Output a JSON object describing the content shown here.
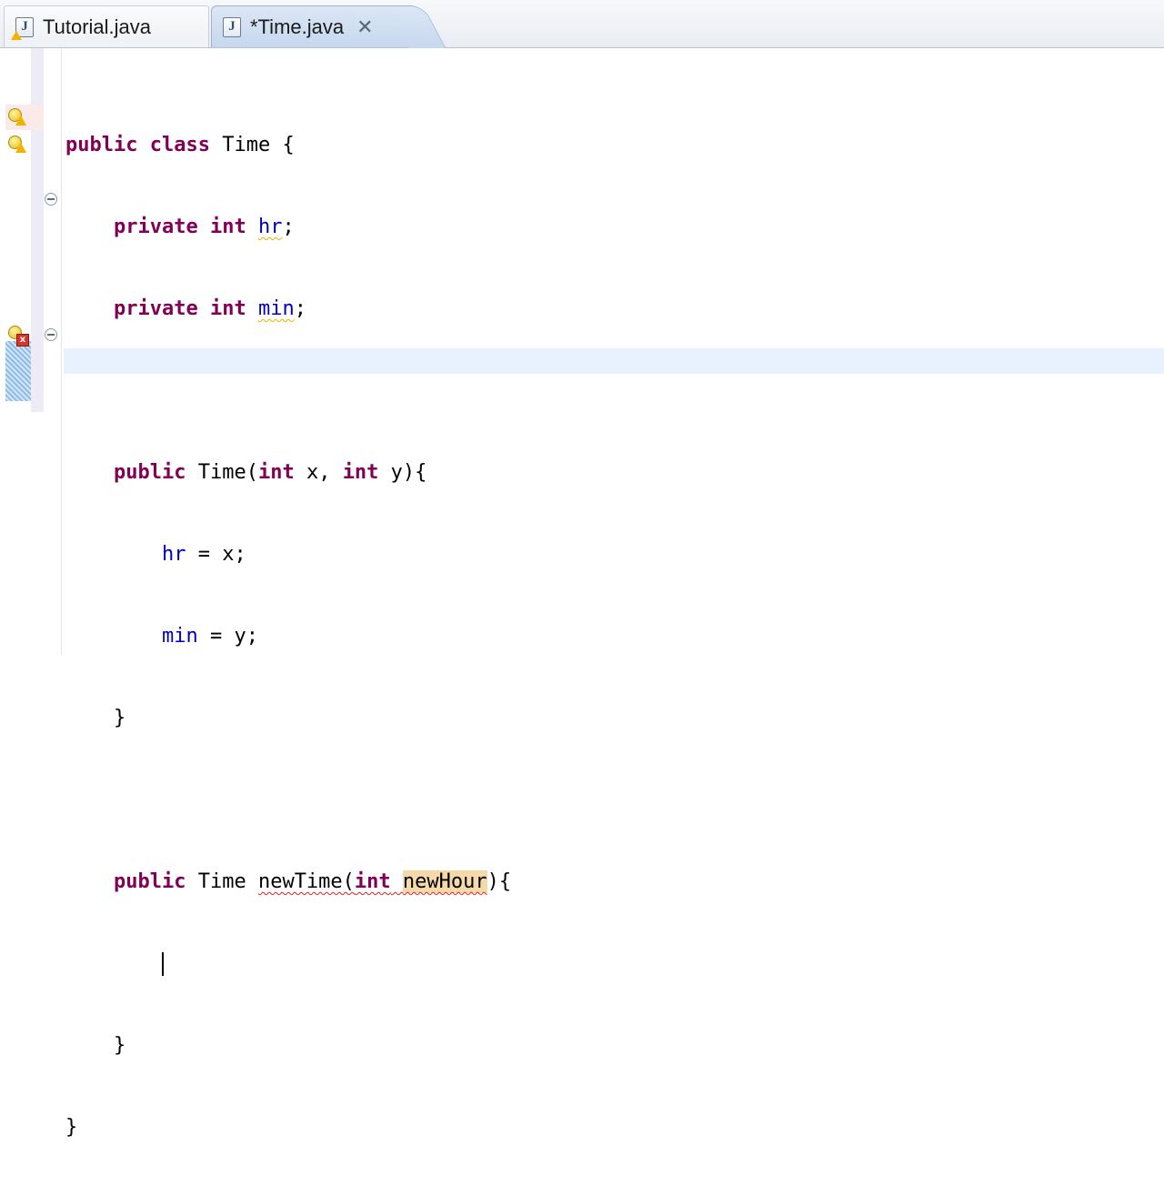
{
  "tabs": [
    {
      "label": "Tutorial.java",
      "active": false,
      "icon": "java-file-warning-icon"
    },
    {
      "label": "*Time.java",
      "active": true,
      "icon": "java-file-icon",
      "close_glyph": "✕"
    }
  ],
  "colors": {
    "keyword": "#7f0055",
    "field": "#0000c0",
    "current_line": "#e8f2fe",
    "occurrence": "#f5d9a8",
    "warning": "#e4b400",
    "error": "#e02020"
  },
  "code": {
    "l1": {
      "kw1": "public",
      "kw2": "class",
      "rest": " Time {"
    },
    "l2": {
      "indent": "    ",
      "kw1": "private",
      "kw2": "int",
      "field": "hr",
      "end": ";"
    },
    "l3": {
      "indent": "    ",
      "kw1": "private",
      "kw2": "int",
      "field": "min",
      "end": ";"
    },
    "l5": {
      "indent": "    ",
      "kw1": "public",
      "a": " Time(",
      "kw2": "int",
      "b": " x, ",
      "kw3": "int",
      "c": " y){"
    },
    "l6": {
      "indent": "        ",
      "field": "hr",
      "rest": " = x;"
    },
    "l7": {
      "indent": "        ",
      "field": "min",
      "rest": " = y;"
    },
    "l8": {
      "text": "    }"
    },
    "l10": {
      "indent": "    ",
      "kw1": "public",
      "a": " Time ",
      "method": "newTime(",
      "kw2": "int",
      "param": "newHour",
      "c": "){"
    },
    "l11": {
      "indent": "        "
    },
    "l12": {
      "text": "    }"
    },
    "l13": {
      "text": "}"
    }
  }
}
